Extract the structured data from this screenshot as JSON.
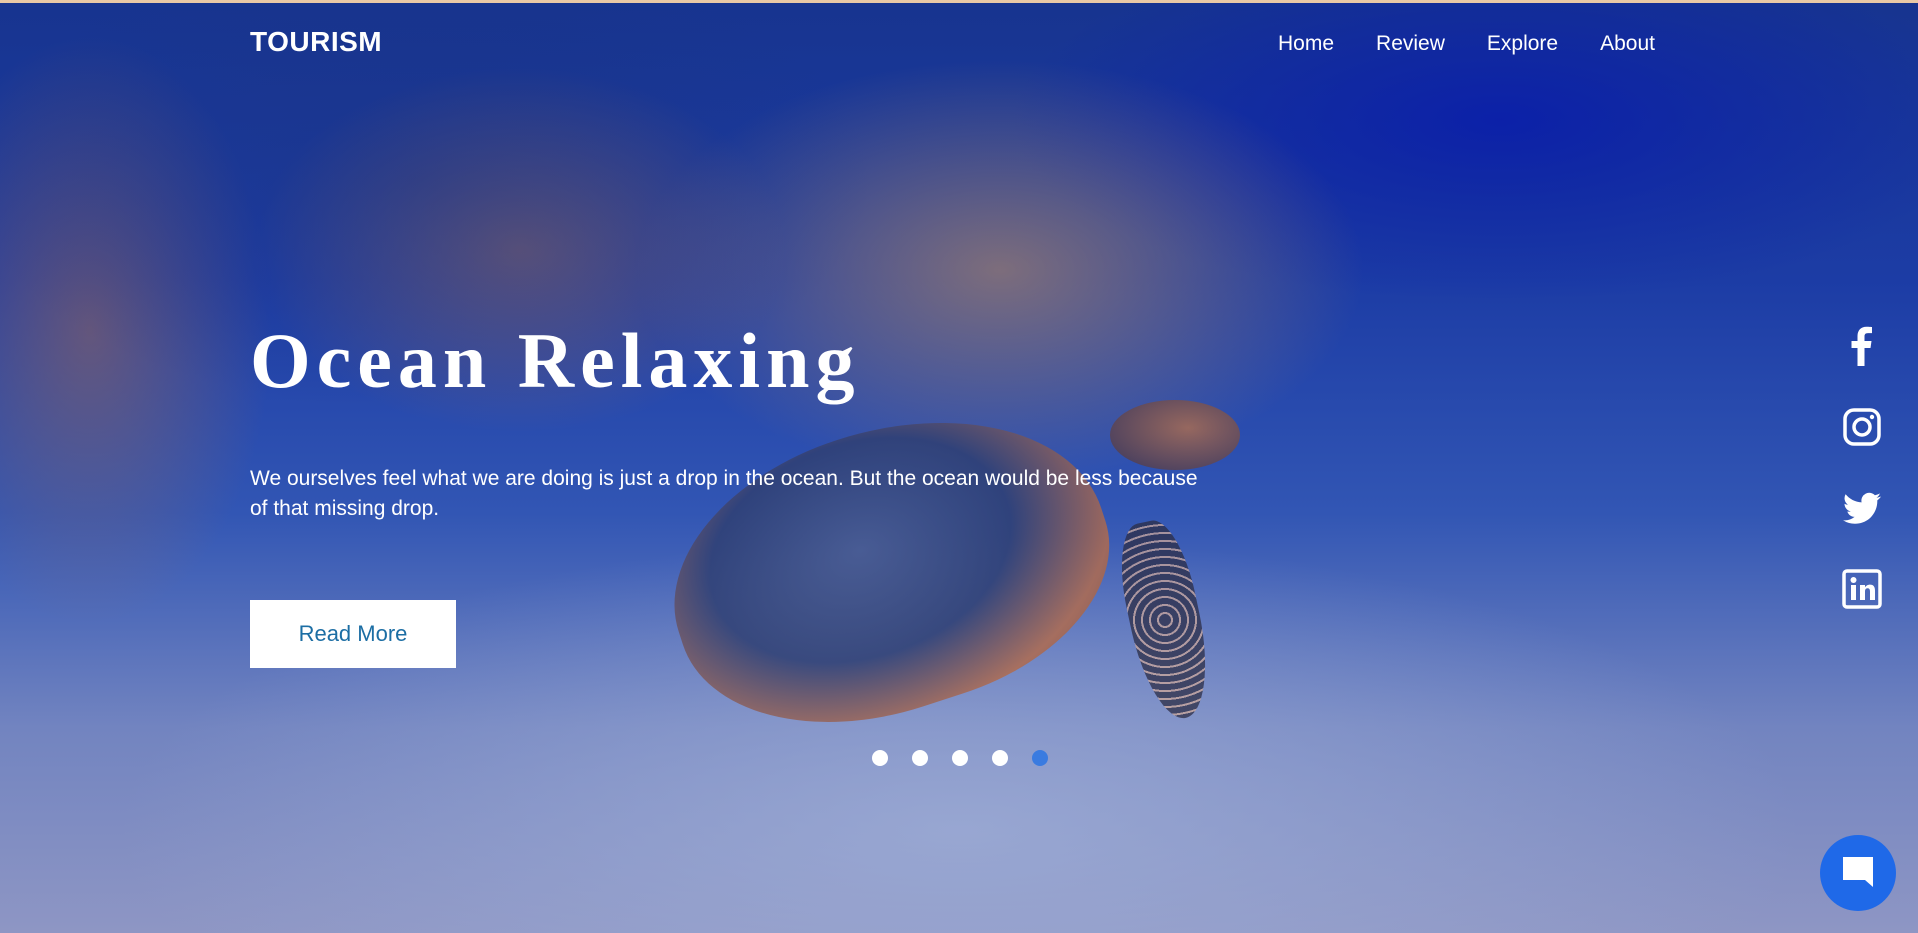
{
  "brand": {
    "name": "TOURISM"
  },
  "nav": {
    "items": [
      {
        "label": "Home"
      },
      {
        "label": "Review"
      },
      {
        "label": "Explore"
      },
      {
        "label": "About"
      }
    ]
  },
  "hero": {
    "title": "Ocean Relaxing",
    "description": "We ourselves feel what we are doing is just a drop in the ocean. But the ocean would be less because of that missing drop.",
    "cta_label": "Read More"
  },
  "slider": {
    "total": 5,
    "active_index": 5
  },
  "social": {
    "icons": [
      "facebook-icon",
      "instagram-icon",
      "twitter-icon",
      "linkedin-icon"
    ]
  },
  "chat": {
    "icon": "chat-icon"
  },
  "colors": {
    "accent": "#1f69e8",
    "cta_text": "#1c6ea4",
    "active_dot": "#3a7be0",
    "top_strip": "#e9c9a6"
  }
}
